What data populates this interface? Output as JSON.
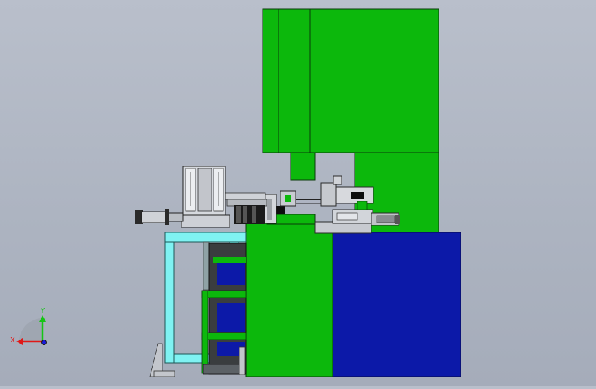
{
  "viewport": {
    "background": "#aeb5c2"
  },
  "colors": {
    "press_green": "#0cb80c",
    "base_blue": "#0c19a8",
    "frame_cyan": "#7ff2f2",
    "steel_grey": "#c9ccd2",
    "dark": "#1b1b1b"
  },
  "triad": {
    "x_label": "X",
    "y_label": "Y",
    "x_color": "#e01818",
    "y_color": "#15c515",
    "z_color": "#1a1ae0"
  }
}
